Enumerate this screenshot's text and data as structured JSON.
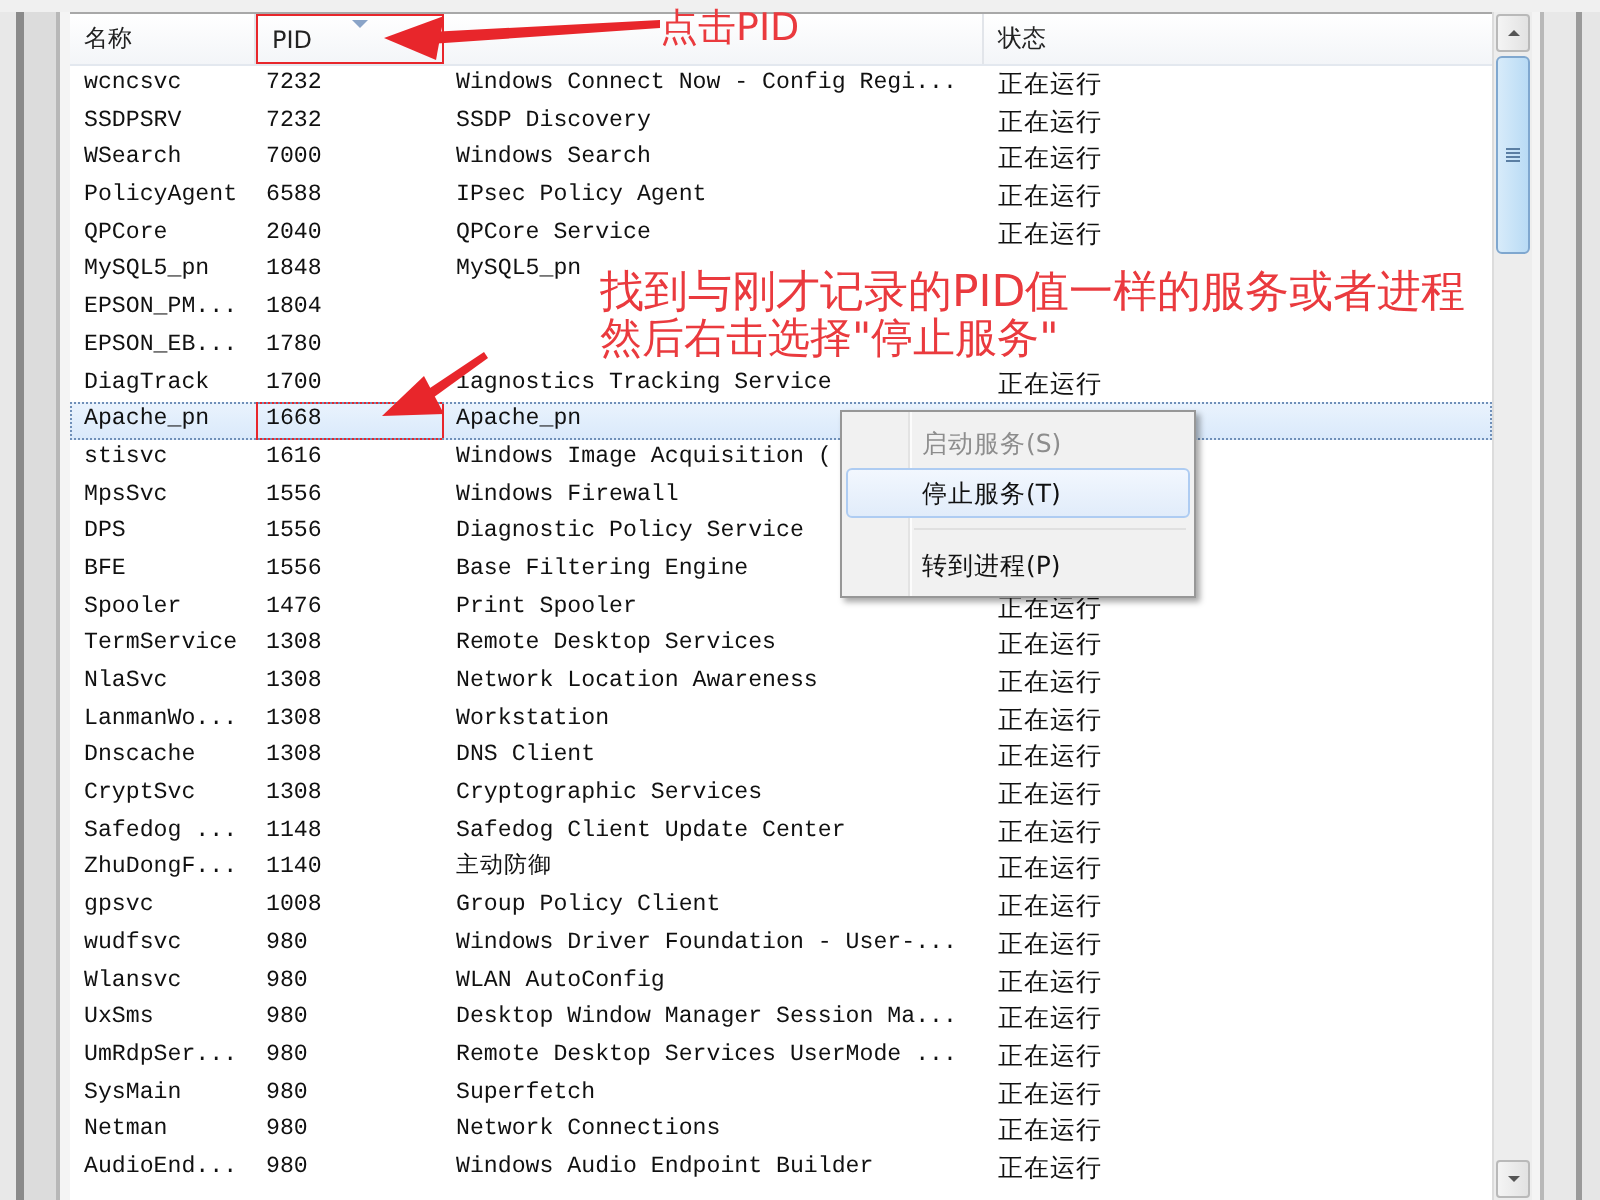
{
  "table": {
    "columns": [
      {
        "label": "名称",
        "marked": false,
        "sorted": false
      },
      {
        "label": "PID",
        "marked": true,
        "sorted": true
      },
      {
        "marked": false,
        "sorted": false
      },
      {
        "label": "状态",
        "marked": false,
        "sorted": false
      }
    ],
    "rows": [
      {
        "name": "wcncsvc",
        "pid": "7232",
        "description": "Windows Connect Now - Config Regi...",
        "status": "正在运行",
        "selected": false,
        "marked": false
      },
      {
        "name": "SSDPSRV",
        "pid": "7232",
        "description": "SSDP Discovery",
        "status": "正在运行",
        "selected": false,
        "marked": false
      },
      {
        "name": "WSearch",
        "pid": "7000",
        "description": "Windows Search",
        "status": "正在运行",
        "selected": false,
        "marked": false
      },
      {
        "name": "PolicyAgent",
        "pid": "6588",
        "description": "IPsec Policy Agent",
        "status": "正在运行",
        "selected": false,
        "marked": false
      },
      {
        "name": "QPCore",
        "pid": "2040",
        "description": "QPCore Service",
        "status": "正在运行",
        "selected": false,
        "marked": false
      },
      {
        "name": "MySQL5_pn",
        "pid": "1848",
        "description": "MySQL5_pn",
        "selected": false,
        "marked": false
      },
      {
        "name": "EPSON_PM...",
        "pid": "1804",
        "selected": false,
        "marked": false
      },
      {
        "name": "EPSON_EB...",
        "pid": "1780",
        "selected": false,
        "marked": false
      },
      {
        "name": "DiagTrack",
        "pid": "1700",
        "description": "iagnostics Tracking Service",
        "status": "正在运行",
        "selected": false,
        "marked": false
      },
      {
        "name": "Apache_pn",
        "pid": "1668",
        "description": "Apache_pn",
        "selected": true,
        "marked": true
      },
      {
        "name": "stisvc",
        "pid": "1616",
        "description": "Windows Image Acquisition (",
        "selected": false,
        "marked": false
      },
      {
        "name": "MpsSvc",
        "pid": "1556",
        "description": "Windows Firewall",
        "selected": false,
        "marked": false
      },
      {
        "name": "DPS",
        "pid": "1556",
        "description": "Diagnostic Policy Service",
        "selected": false,
        "marked": false
      },
      {
        "name": "BFE",
        "pid": "1556",
        "description": "Base Filtering Engine",
        "selected": false,
        "marked": false
      },
      {
        "name": "Spooler",
        "pid": "1476",
        "description": "Print Spooler",
        "status": "正在运行",
        "selected": false,
        "marked": false
      },
      {
        "name": "TermService",
        "pid": "1308",
        "description": "Remote Desktop Services",
        "status": "正在运行",
        "selected": false,
        "marked": false
      },
      {
        "name": "NlaSvc",
        "pid": "1308",
        "description": "Network Location Awareness",
        "status": "正在运行",
        "selected": false,
        "marked": false
      },
      {
        "name": "LanmanWo...",
        "pid": "1308",
        "description": "Workstation",
        "status": "正在运行",
        "selected": false,
        "marked": false
      },
      {
        "name": "Dnscache",
        "pid": "1308",
        "description": "DNS Client",
        "status": "正在运行",
        "selected": false,
        "marked": false
      },
      {
        "name": "CryptSvc",
        "pid": "1308",
        "description": "Cryptographic Services",
        "status": "正在运行",
        "selected": false,
        "marked": false
      },
      {
        "name": "Safedog ...",
        "pid": "1148",
        "description": "Safedog Client Update Center",
        "status": "正在运行",
        "selected": false,
        "marked": false
      },
      {
        "name": "ZhuDongF...",
        "pid": "1140",
        "description": "主动防御",
        "status": "正在运行",
        "selected": false,
        "marked": false
      },
      {
        "name": "gpsvc",
        "pid": "1008",
        "description": "Group Policy Client",
        "status": "正在运行",
        "selected": false,
        "marked": false
      },
      {
        "name": "wudfsvc",
        "pid": "980",
        "description": "Windows Driver Foundation - User-...",
        "status": "正在运行",
        "selected": false,
        "marked": false
      },
      {
        "name": "Wlansvc",
        "pid": "980",
        "description": "WLAN AutoConfig",
        "status": "正在运行",
        "selected": false,
        "marked": false
      },
      {
        "name": "UxSms",
        "pid": "980",
        "description": "Desktop Window Manager Session Ma...",
        "status": "正在运行",
        "selected": false,
        "marked": false
      },
      {
        "name": "UmRdpSer...",
        "pid": "980",
        "description": "Remote Desktop Services UserMode ...",
        "status": "正在运行",
        "selected": false,
        "marked": false
      },
      {
        "name": "SysMain",
        "pid": "980",
        "description": "Superfetch",
        "status": "正在运行",
        "selected": false,
        "marked": false
      },
      {
        "name": "Netman",
        "pid": "980",
        "description": "Network Connections",
        "status": "正在运行",
        "selected": false,
        "marked": false
      },
      {
        "name": "AudioEnd...",
        "pid": "980",
        "description": "Windows Audio Endpoint Builder",
        "status": "正在运行",
        "selected": false,
        "marked": false
      }
    ]
  },
  "context_menu": {
    "items": [
      {
        "kind": "item",
        "label": "启动服务(S)",
        "disabled": true,
        "selected": false
      },
      {
        "kind": "item",
        "label": "停止服务(T)",
        "disabled": false,
        "selected": true
      },
      {
        "kind": "separator"
      },
      {
        "kind": "item",
        "label": "转到进程(P)",
        "disabled": false,
        "selected": false
      }
    ]
  },
  "annotations": [
    {
      "text": "点击PID"
    },
    {
      "text": "找到与刚才记录的PID值一样的服务或者进程"
    },
    {
      "text": "然后右击选择\"停止服务\""
    }
  ]
}
